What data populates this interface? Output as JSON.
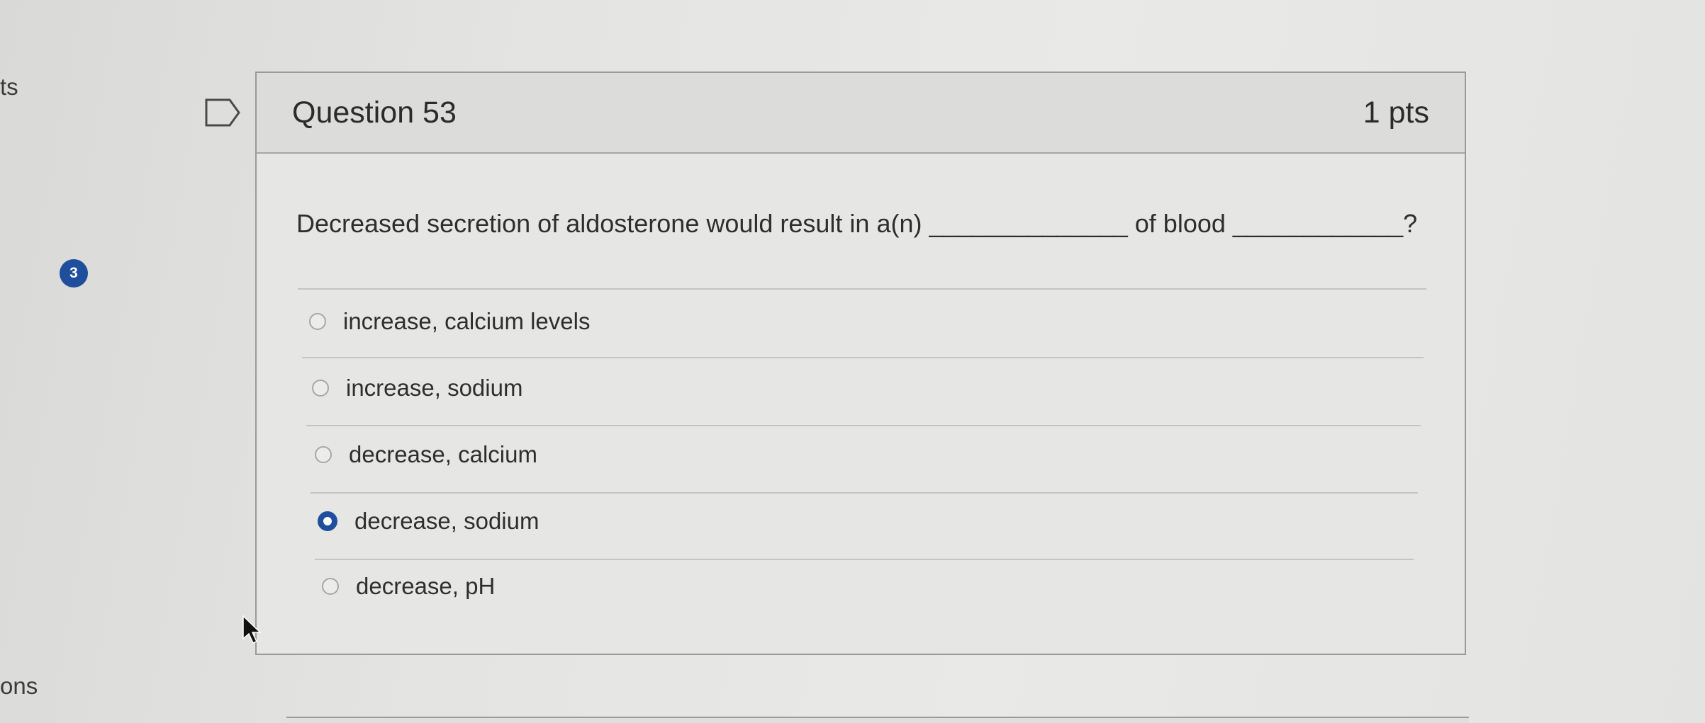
{
  "sidebar": {
    "top_fragment": "ts",
    "bottom_fragment": "ons",
    "question_number_badge": "3"
  },
  "question": {
    "title": "Question 53",
    "points": "1 pts",
    "text": "Decreased secretion of aldosterone would result in a(n) ______________ of blood ____________?",
    "answers": [
      {
        "label": "increase, calcium levels",
        "selected": false
      },
      {
        "label": "increase, sodium",
        "selected": false
      },
      {
        "label": "decrease, calcium",
        "selected": false
      },
      {
        "label": "decrease, sodium",
        "selected": true
      },
      {
        "label": "decrease, pH",
        "selected": false
      }
    ]
  },
  "icons": {
    "flag": "flag-icon",
    "cursor": "mouse-pointer-icon"
  },
  "colors": {
    "accent": "#1f4e9c",
    "background": "#e6e6e4"
  }
}
